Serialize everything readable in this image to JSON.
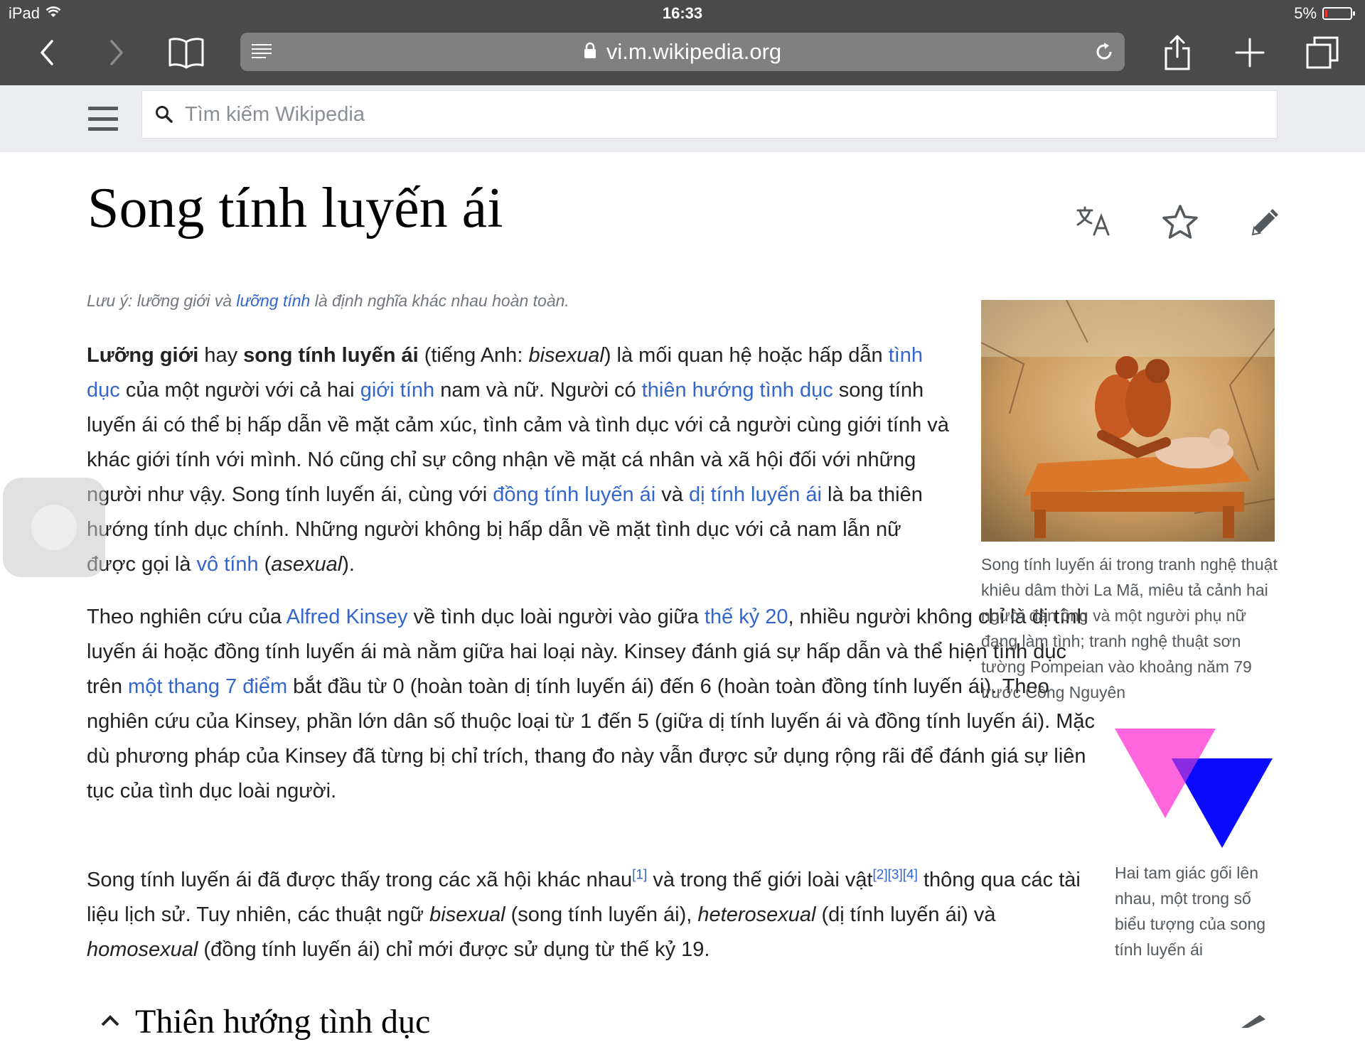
{
  "status_bar": {
    "device": "iPad",
    "time": "16:33",
    "battery": "5%"
  },
  "browser": {
    "url": "vi.m.wikipedia.org",
    "icons": {
      "back": "chevron-left-icon",
      "forward": "chevron-right-icon",
      "bookmarks": "book-icon",
      "reader": "reader-list-icon",
      "lock": "lock-icon",
      "reload": "reload-icon",
      "share": "share-icon",
      "new_tab": "plus-icon",
      "tabs": "tabs-icon"
    }
  },
  "wiki_header": {
    "search_placeholder": "Tìm kiếm Wikipedia"
  },
  "article": {
    "title": "Song tính luyến ái",
    "hatnote": {
      "prefix": "Lưu ý: lưỡng giới và ",
      "link": "lưỡng tính",
      "suffix": " là định nghĩa khác nhau hoàn toàn."
    },
    "para1": {
      "b1": "Lưỡng giới",
      "t1": " hay ",
      "b2": "song tính luyến ái",
      "t2": " (tiếng Anh: ",
      "i1": "bisexual",
      "t3": ") là mối quan hệ hoặc hấp dẫn ",
      "l1": "tình dục",
      "t4": " của một người với cả hai ",
      "l2": "giới tính",
      "t5": " nam và nữ. Người có ",
      "l3": "thiên hướng tình dục",
      "t6": " song tính luyến ái có thể bị hấp dẫn về mặt cảm xúc, tình cảm và tình dục với cả người cùng giới tính và khác giới tính với mình. Nó cũng chỉ sự công nhận về mặt cá nhân và xã hội đối với những người như vậy. Song tính luyến ái, cùng với ",
      "l4": "đồng tính luyến ái",
      "t7": " và ",
      "l5": "dị tính luyến ái",
      "t8": " là ba thiên hướng tính dục chính. Những người không bị hấp dẫn về mặt tình dục với cả nam lẫn nữ được gọi là ",
      "l6": "vô tính",
      "t9": " (",
      "i2": "asexual",
      "t10": ")."
    },
    "para2": {
      "t1": "Theo nghiên cứu của ",
      "l1": "Alfred Kinsey",
      "t2": " về tình dục loài người vào giữa ",
      "l2": "thế kỷ 20",
      "t3": ", nhiều người không chỉ là dị tính luyến ái hoặc đồng tính luyến ái mà nằm giữa hai loại này. Kinsey đánh giá sự hấp dẫn và thể hiện tình dục trên ",
      "l3": "một thang 7 điểm",
      "t4": " bắt đầu từ 0 (hoàn toàn dị tính luyến ái) đến 6 (hoàn toàn đồng tính luyến ái). Theo nghiên cứu của Kinsey, phần lớn dân số thuộc loại từ 1 đến 5 (giữa dị tính luyến ái và đồng tính luyến ái). Mặc dù phương pháp của Kinsey đã từng bị chỉ trích, thang đo này vẫn được sử dụng rộng rãi để đánh giá sự liên tục của tình dục loài người."
    },
    "para3": {
      "t1": "Song tính luyến ái đã được thấy trong các xã hội khác nhau",
      "ref1": "[1]",
      "t2": " và trong thế giới loài vật",
      "ref2": "[2]",
      "ref3": "[3]",
      "ref4": "[4]",
      "t3": " thông qua các tài liệu lịch sử. Tuy nhiên, các thuật ngữ ",
      "i1": "bisexual",
      "t4": " (song tính luyến ái), ",
      "i2": "heterosexual",
      "t5": " (dị tính luyến ái) và ",
      "i3": "homosexual",
      "t6": " (đồng tính luyến ái) chỉ mới được sử dụng từ thế kỷ 19."
    },
    "figure1": {
      "caption": "Song tính luyến ái trong tranh nghệ thuật khiêu dâm thời La Mã, miêu tả cảnh hai người đàn ông và một người phụ nữ đang làm tình; tranh nghệ thuật sơn tường Pompeian vào khoảng năm 79 trước Công Nguyên"
    },
    "figure2": {
      "caption": "Hai tam giác gối lên nhau, một trong số biểu tượng của song tính luyến ái",
      "colors": {
        "pink": "#ff66dd",
        "blue": "#0a0aff",
        "overlap": "#8a2be2"
      }
    },
    "section_heading": "Thiên hướng tình dục"
  },
  "colors": {
    "link": "#3366cc",
    "chrome": "#4a4a4a",
    "header": "#eaecf0"
  }
}
